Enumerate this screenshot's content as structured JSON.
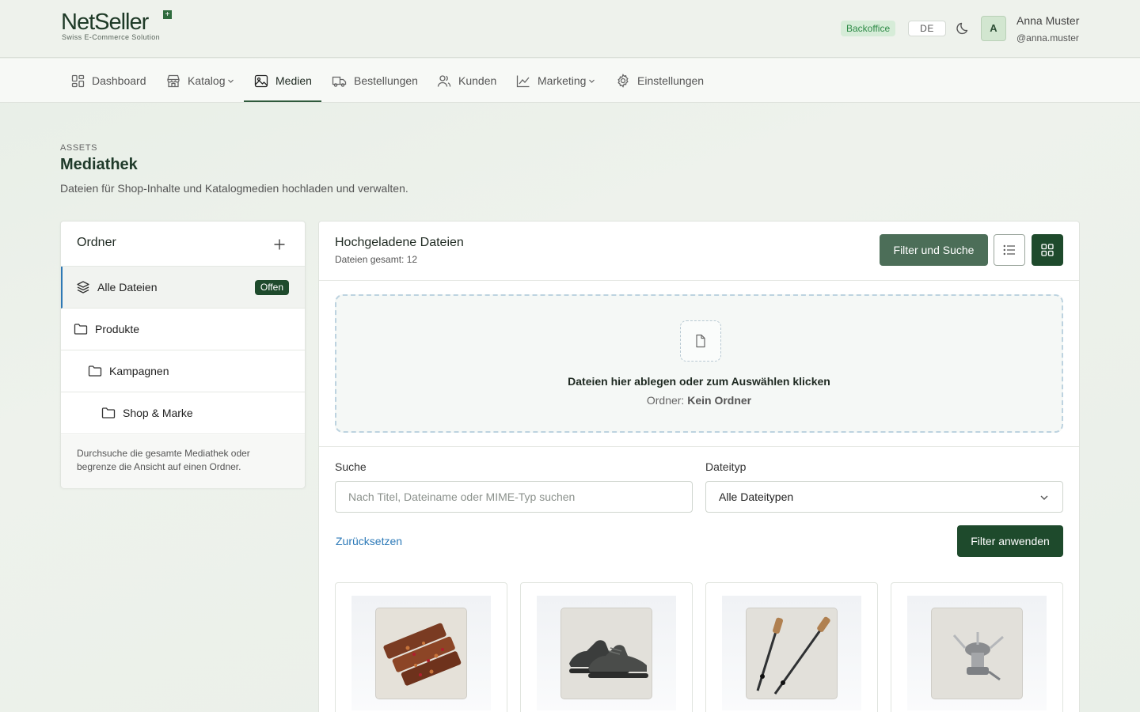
{
  "brand": {
    "name_part1": "Net",
    "name_part2": "Seller",
    "tagline": "Swiss E-Commerce Solution",
    "accent": "#1e4a2c"
  },
  "header": {
    "badge": "Backoffice",
    "language": "DE",
    "user": {
      "initial": "A",
      "name": "Anna Muster",
      "handle": "@anna.muster"
    }
  },
  "nav": {
    "items": [
      {
        "label": "Dashboard",
        "icon": "dashboard-icon"
      },
      {
        "label": "Katalog",
        "icon": "store-icon",
        "has_dropdown": true
      },
      {
        "label": "Medien",
        "icon": "image-icon",
        "active": true
      },
      {
        "label": "Bestellungen",
        "icon": "truck-icon"
      },
      {
        "label": "Kunden",
        "icon": "users-icon"
      },
      {
        "label": "Marketing",
        "icon": "chart-icon",
        "has_dropdown": true
      },
      {
        "label": "Einstellungen",
        "icon": "gear-icon"
      }
    ]
  },
  "page": {
    "eyebrow": "ASSETS",
    "title": "Mediathek",
    "description": "Dateien für Shop-Inhalte und Katalogmedien hochladen und verwalten."
  },
  "folders": {
    "title": "Ordner",
    "items": [
      {
        "label": "Alle Dateien",
        "badge": "Offen",
        "active": true
      },
      {
        "label": "Produkte"
      },
      {
        "label": "Kampagnen"
      },
      {
        "label": "Shop & Marke"
      }
    ],
    "hint": "Durchsuche die gesamte Mediathek oder begrenze die Ansicht auf einen Ordner."
  },
  "files": {
    "title": "Hochgeladene Dateien",
    "count_text": "Dateien gesamt: 12",
    "filter_button": "Filter und Suche",
    "view_modes": {
      "list": "list-view-icon",
      "grid": "grid-view-icon",
      "active": "grid"
    },
    "dropzone": {
      "title": "Dateien hier ablegen oder zum Auswählen klicken",
      "folder_label": "Ordner:",
      "folder_value": "Kein Ordner"
    },
    "search": {
      "label": "Suche",
      "placeholder": "Nach Titel, Dateiname oder MIME-Typ suchen",
      "value": ""
    },
    "type_filter": {
      "label": "Dateityp",
      "selected": "Alle Dateitypen"
    },
    "reset_link": "Zurücksetzen",
    "apply_button": "Filter anwenden",
    "thumbnails": [
      {
        "name": "energy-bars-thumbnail"
      },
      {
        "name": "hiking-shoes-thumbnail"
      },
      {
        "name": "trekking-poles-thumbnail"
      },
      {
        "name": "camping-stove-thumbnail"
      }
    ]
  }
}
